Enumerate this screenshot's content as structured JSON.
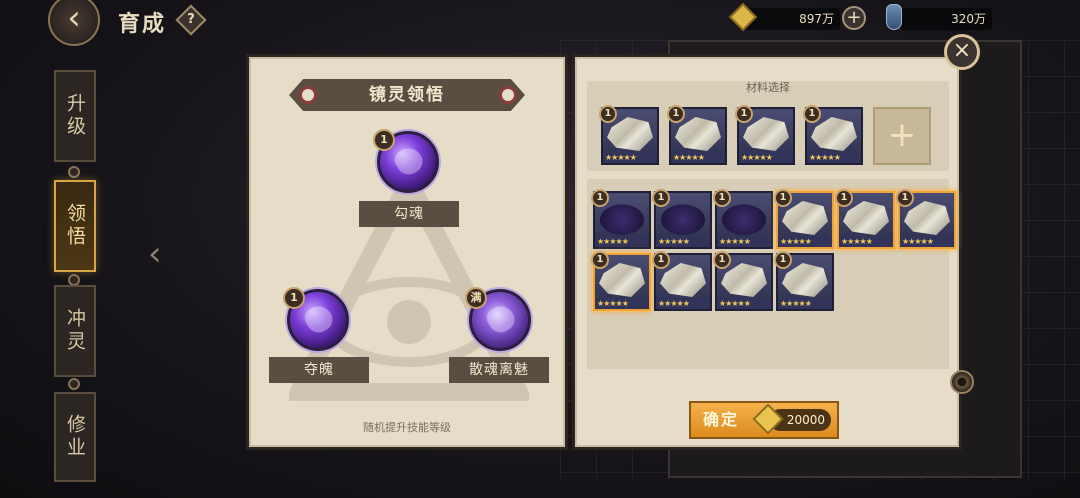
{
  "top_bar": {
    "title": "育成",
    "help_glyph": "?",
    "gold_amount": "897万",
    "potion_amount": "320万",
    "plus_glyph": "+"
  },
  "side_tabs": [
    {
      "label": "升级",
      "active": false
    },
    {
      "label": "领悟",
      "active": true
    },
    {
      "label": "冲灵",
      "active": false
    },
    {
      "label": "修业",
      "active": false
    }
  ],
  "left_panel": {
    "banner_title": "镜灵领悟",
    "skills": [
      {
        "name": "勾魂",
        "badge": "1"
      },
      {
        "name": "夺魄",
        "badge": "1"
      },
      {
        "name": "散魂离魅",
        "badge": "满"
      }
    ],
    "hint": "随机提升技能等级"
  },
  "right_panel": {
    "section_title": "材料选择",
    "selected_materials": [
      {
        "level": "1",
        "kind": "shikigami"
      },
      {
        "level": "1",
        "kind": "shikigami"
      },
      {
        "level": "1",
        "kind": "shikigami"
      },
      {
        "level": "1",
        "kind": "shikigami"
      }
    ],
    "add_slot_glyph": "+",
    "inventory": [
      {
        "level": "1",
        "kind": "soul",
        "selected": false
      },
      {
        "level": "1",
        "kind": "soul",
        "selected": false
      },
      {
        "level": "1",
        "kind": "soul",
        "selected": false
      },
      {
        "level": "1",
        "kind": "shikigami",
        "selected": true
      },
      {
        "level": "1",
        "kind": "shikigami",
        "selected": true
      },
      {
        "level": "1",
        "kind": "shikigami",
        "selected": true
      },
      {
        "level": "1",
        "kind": "shikigami",
        "selected": true
      },
      {
        "level": "1",
        "kind": "shikigami",
        "selected": false
      },
      {
        "level": "1",
        "kind": "shikigami",
        "selected": false
      },
      {
        "level": "1",
        "kind": "shikigami",
        "selected": false
      }
    ],
    "confirm_label": "确定",
    "confirm_cost": "20000"
  },
  "close_glyph": "×",
  "colors": {
    "accent": "#f0a23a",
    "panel": "#e6ddc9",
    "banner": "#5a4e42",
    "skill_purple": "#7c3ed9"
  }
}
